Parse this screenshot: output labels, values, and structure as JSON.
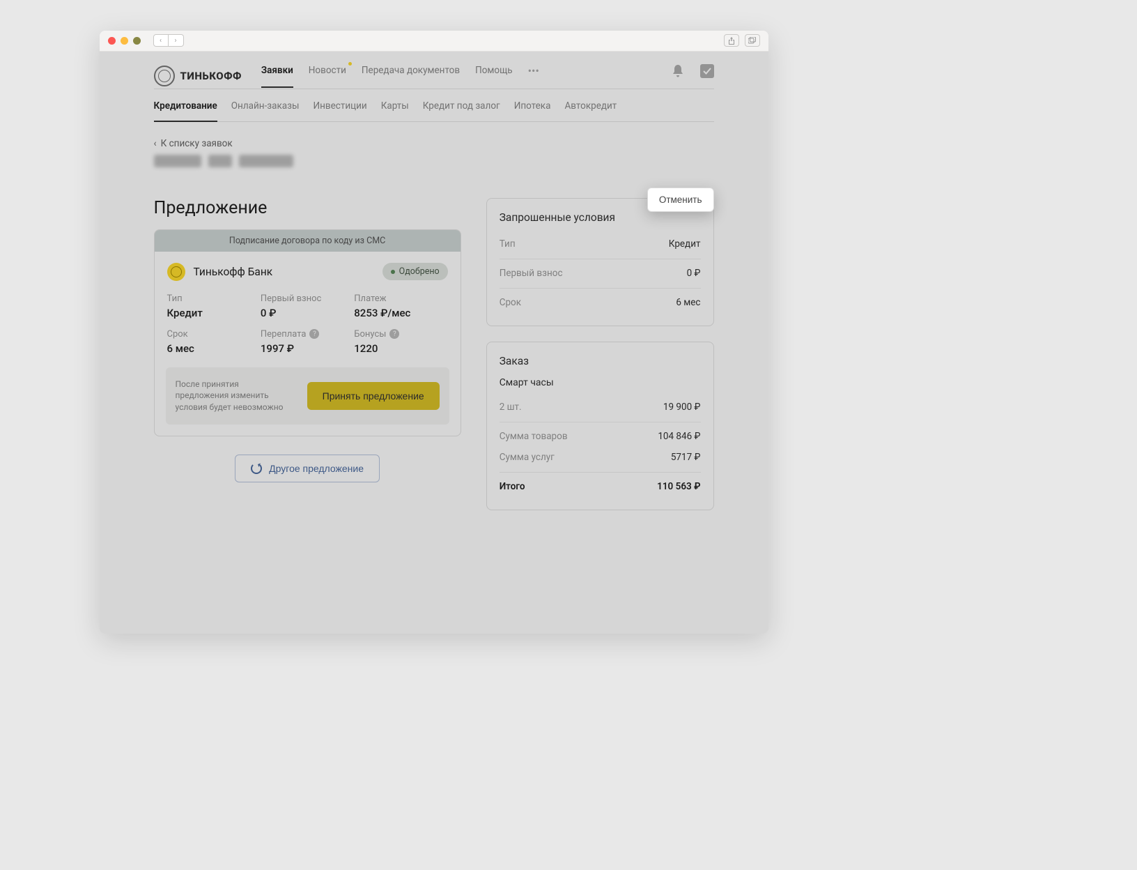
{
  "brand": {
    "name": "ТИНЬКОФФ"
  },
  "topnav": {
    "items": [
      "Заявки",
      "Новости",
      "Передача документов",
      "Помощь"
    ],
    "active": 0,
    "dot_index": 1
  },
  "subnav": {
    "items": [
      "Кредитование",
      "Онлайн-заказы",
      "Инвестиции",
      "Карты",
      "Кредит под залог",
      "Ипотека",
      "Автокредит"
    ],
    "active": 0
  },
  "back_link": "К списку заявок",
  "cancel_button": "Отменить",
  "offer": {
    "title": "Предложение",
    "sms_banner": "Подписание договора по коду из СМС",
    "bank_name": "Тинькофф Банк",
    "status": "Одобрено",
    "fields": {
      "type_label": "Тип",
      "type_value": "Кредит",
      "first_payment_label": "Первый взнос",
      "first_payment_value": "0 ₽",
      "payment_label": "Платеж",
      "payment_value": "8253 ₽/мес",
      "term_label": "Срок",
      "term_value": "6 мес",
      "overpay_label": "Переплата",
      "overpay_value": "1997 ₽",
      "bonus_label": "Бонусы",
      "bonus_value": "1220"
    },
    "footer_text": "После принятия предложения изменить условия будет невозможно",
    "accept_button": "Принять предложение",
    "other_button": "Другое предложение"
  },
  "requested": {
    "title": "Запрошенные условия",
    "rows": [
      {
        "k": "Тип",
        "v": "Кредит"
      },
      {
        "k": "Первый взнос",
        "v": "0 ₽"
      },
      {
        "k": "Срок",
        "v": "6 мес"
      }
    ]
  },
  "order": {
    "title": "Заказ",
    "item_name": "Смарт часы",
    "qty_row": {
      "k": "2 шт.",
      "v": "19 900 ₽"
    },
    "rows": [
      {
        "k": "Сумма товаров",
        "v": "104 846 ₽"
      },
      {
        "k": "Сумма услуг",
        "v": "5717 ₽"
      }
    ],
    "total": {
      "k": "Итого",
      "v": "110 563 ₽"
    }
  }
}
